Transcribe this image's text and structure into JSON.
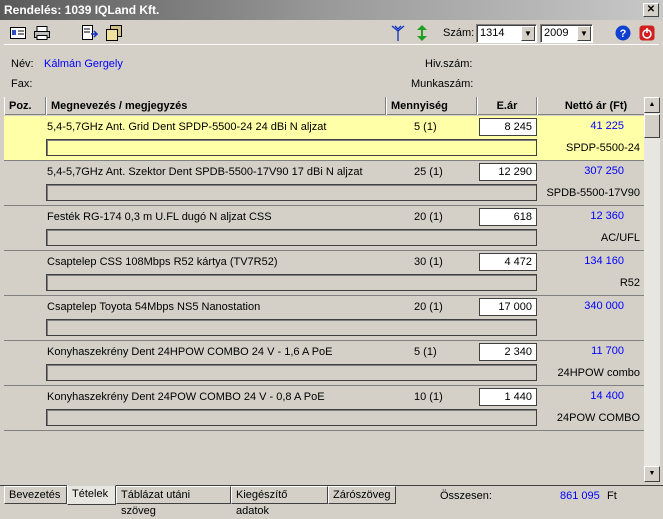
{
  "title": "Rendelés: 1039 IQLand Kft.",
  "toolbar": {
    "szam_label": "Szám:",
    "szam_value": "1314",
    "year_value": "2009"
  },
  "info": {
    "nev_label": "Név:",
    "nev_value": "Kálmán Gergely",
    "fax_label": "Fax:",
    "hiv_label": "Hiv.szám:",
    "munka_label": "Munkaszám:"
  },
  "columns": {
    "poz": "Poz.",
    "name": "Megnevezés / megjegyzés",
    "qty": "Mennyiség",
    "price": "E.ár",
    "net": "Nettó ár (Ft)"
  },
  "rows": [
    {
      "name": "5,4-5,7GHz Ant. Grid Dent SPDP-5500-24 24 dBi N aljzat",
      "qty": "5 (1)",
      "price": "8 245",
      "net": "41 225",
      "code": "SPDP-5500-24"
    },
    {
      "name": "5,4-5,7GHz Ant. Szektor Dent SPDB-5500-17V90 17 dBi N aljzat",
      "qty": "25 (1)",
      "price": "12 290",
      "net": "307 250",
      "code": "SPDB-5500-17V90"
    },
    {
      "name": "Festék RG-174  0,3 m U.FL dugó N aljzat CSS",
      "qty": "20 (1)",
      "price": "618",
      "net": "12 360",
      "code": "AC/UFL"
    },
    {
      "name": "Csaptelep CSS 108Mbps R52 kártya (TV7R52)",
      "qty": "30 (1)",
      "price": "4 472",
      "net": "134 160",
      "code": "R52"
    },
    {
      "name": "Csaptelep Toyota 54Mbps NS5 Nanostation",
      "qty": "20 (1)",
      "price": "17 000",
      "net": "340 000",
      "code": ""
    },
    {
      "name": "Konyhaszekrény Dent 24HPOW COMBO 24 V - 1,6 A PoE",
      "qty": "5 (1)",
      "price": "2 340",
      "net": "11 700",
      "code": "24HPOW combo"
    },
    {
      "name": "Konyhaszekrény Dent 24POW COMBO 24 V - 0,8 A PoE",
      "qty": "10 (1)",
      "price": "1 440",
      "net": "14 400",
      "code": "24POW COMBO"
    }
  ],
  "tabs": [
    "Bevezetés",
    "Tételek",
    "Táblázat utáni szöveg",
    "Kiegészítő adatok",
    "Zárószöveg"
  ],
  "footer": {
    "total_label": "Összesen:",
    "total_value": "861 095",
    "currency": "Ft"
  }
}
